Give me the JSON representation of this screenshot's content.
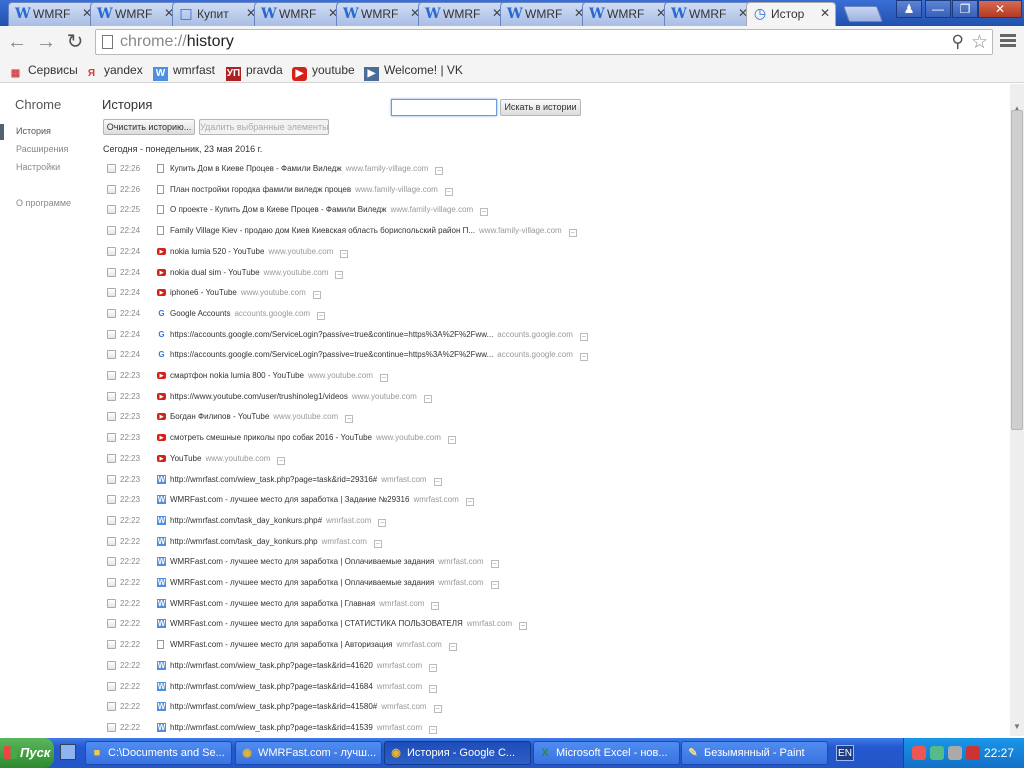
{
  "tabs": [
    {
      "label": "WMRF",
      "icon": "wmrfast-icon"
    },
    {
      "label": "WMRF",
      "icon": "wmrfast-icon"
    },
    {
      "label": "Купит",
      "icon": "page-icon"
    },
    {
      "label": "WMRF",
      "icon": "wmrfast-icon"
    },
    {
      "label": "WMRF",
      "icon": "wmrfast-icon"
    },
    {
      "label": "WMRF",
      "icon": "wmrfast-icon"
    },
    {
      "label": "WMRF",
      "icon": "wmrfast-icon"
    },
    {
      "label": "WMRF",
      "icon": "wmrfast-icon"
    },
    {
      "label": "WMRF",
      "icon": "wmrfast-icon"
    },
    {
      "label": "Истор",
      "icon": "history-icon",
      "active": true
    }
  ],
  "omnibox": {
    "scheme": "chrome://",
    "path": "history"
  },
  "bookmarks": [
    {
      "label": "Сервисы",
      "icon": "apps-icon"
    },
    {
      "label": "yandex",
      "icon": "yandex-icon"
    },
    {
      "label": "wmrfast",
      "icon": "wmrfast-icon"
    },
    {
      "label": "pravda",
      "icon": "pravda-icon"
    },
    {
      "label": "youtube",
      "icon": "youtube-icon"
    },
    {
      "label": "Welcome! | VK",
      "icon": "vk-icon"
    }
  ],
  "sidebar": {
    "brand": "Chrome",
    "items": [
      "История",
      "Расширения",
      "Настройки"
    ],
    "about": "О программе"
  },
  "page": {
    "title": "История",
    "clear_button": "Очистить историю...",
    "delete_button": "Удалить выбранные элементы",
    "search_button": "Искать в истории",
    "search_value": "",
    "day_label": "Сегодня - понедельник, 23 мая 2016 г."
  },
  "history": [
    {
      "time": "22:26",
      "icon": "page",
      "title": "Купить Дом в Киеве Процев - Фамили Виледж",
      "domain": "www.family-village.com"
    },
    {
      "time": "22:26",
      "icon": "page",
      "title": "План постройки городка фамили виледж процев",
      "domain": "www.family-village.com"
    },
    {
      "time": "22:25",
      "icon": "page",
      "title": "О проекте - Купить Дом в Киеве Процев - Фамили Виледж",
      "domain": "www.family-village.com"
    },
    {
      "time": "22:24",
      "icon": "page",
      "title": "Family Village Kiev - продаю дом Киев Киевская область бориспольский район П...",
      "domain": "www.family-village.com"
    },
    {
      "time": "22:24",
      "icon": "yt",
      "title": "nokia lumia 520 - YouTube",
      "domain": "www.youtube.com"
    },
    {
      "time": "22:24",
      "icon": "yt",
      "title": "nokia dual sim - YouTube",
      "domain": "www.youtube.com"
    },
    {
      "time": "22:24",
      "icon": "yt",
      "title": "iphone6 - YouTube",
      "domain": "www.youtube.com"
    },
    {
      "time": "22:24",
      "icon": "g",
      "title": "Google Accounts",
      "domain": "accounts.google.com"
    },
    {
      "time": "22:24",
      "icon": "g",
      "title": "https://accounts.google.com/ServiceLogin?passive=true&continue=https%3A%2F%2Fww...",
      "domain": "accounts.google.com"
    },
    {
      "time": "22:24",
      "icon": "g",
      "title": "https://accounts.google.com/ServiceLogin?passive=true&continue=https%3A%2F%2Fww...",
      "domain": "accounts.google.com"
    },
    {
      "time": "22:23",
      "icon": "yt",
      "title": "смартфон nokia lumia 800 - YouTube",
      "domain": "www.youtube.com"
    },
    {
      "time": "22:23",
      "icon": "yt",
      "title": "https://www.youtube.com/user/trushinoleg1/videos",
      "domain": "www.youtube.com"
    },
    {
      "time": "22:23",
      "icon": "yt",
      "title": "Богдан Филипов - YouTube",
      "domain": "www.youtube.com"
    },
    {
      "time": "22:23",
      "icon": "yt",
      "title": "смотреть смешные приколы про собак 2016 - YouTube",
      "domain": "www.youtube.com"
    },
    {
      "time": "22:23",
      "icon": "yt",
      "title": "YouTube",
      "domain": "www.youtube.com"
    },
    {
      "time": "22:23",
      "icon": "w",
      "title": "http://wmrfast.com/wiew_task.php?page=task&rid=29316#",
      "domain": "wmrfast.com"
    },
    {
      "time": "22:23",
      "icon": "w",
      "title": "WMRFast.com - лучшее место для заработка | Задание №29316",
      "domain": "wmrfast.com"
    },
    {
      "time": "22:22",
      "icon": "w",
      "title": "http://wmrfast.com/task_day_konkurs.php#",
      "domain": "wmrfast.com"
    },
    {
      "time": "22:22",
      "icon": "w",
      "title": "http://wmrfast.com/task_day_konkurs.php",
      "domain": "wmrfast.com"
    },
    {
      "time": "22:22",
      "icon": "w",
      "title": "WMRFast.com - лучшее место для заработка | Оплачиваемые задания",
      "domain": "wmrfast.com"
    },
    {
      "time": "22:22",
      "icon": "w",
      "title": "WMRFast.com - лучшее место для заработка | Оплачиваемые задания",
      "domain": "wmrfast.com"
    },
    {
      "time": "22:22",
      "icon": "w",
      "title": "WMRFast.com - лучшее место для заработка | Главная",
      "domain": "wmrfast.com"
    },
    {
      "time": "22:22",
      "icon": "w",
      "title": "WMRFast.com - лучшее место для заработка | СТАТИСТИКА ПОЛЬЗОВАТЕЛЯ",
      "domain": "wmrfast.com"
    },
    {
      "time": "22:22",
      "icon": "page",
      "title": "WMRFast.com - лучшее место для заработка | Авторизация",
      "domain": "wmrfast.com"
    },
    {
      "time": "22:22",
      "icon": "w",
      "title": "http://wmrfast.com/wiew_task.php?page=task&rid=41620",
      "domain": "wmrfast.com"
    },
    {
      "time": "22:22",
      "icon": "w",
      "title": "http://wmrfast.com/wiew_task.php?page=task&rid=41684",
      "domain": "wmrfast.com"
    },
    {
      "time": "22:22",
      "icon": "w",
      "title": "http://wmrfast.com/wiew_task.php?page=task&rid=41580#",
      "domain": "wmrfast.com"
    },
    {
      "time": "22:22",
      "icon": "w",
      "title": "http://wmrfast.com/wiew_task.php?page=task&rid=41539",
      "domain": "wmrfast.com"
    }
  ],
  "taskbar": {
    "start": "Пуск",
    "tasks": [
      {
        "label": "C:\\Documents and Se...",
        "icon": "folder-icon"
      },
      {
        "label": "WMRFast.com - лучш...",
        "icon": "chrome-icon"
      },
      {
        "label": "История - Google C...",
        "icon": "chrome-icon",
        "active": true
      },
      {
        "label": "Microsoft Excel - нов...",
        "icon": "excel-icon"
      },
      {
        "label": "Безымянный - Paint",
        "icon": "paint-icon"
      }
    ],
    "lang": "EN",
    "clock": "22:27"
  }
}
